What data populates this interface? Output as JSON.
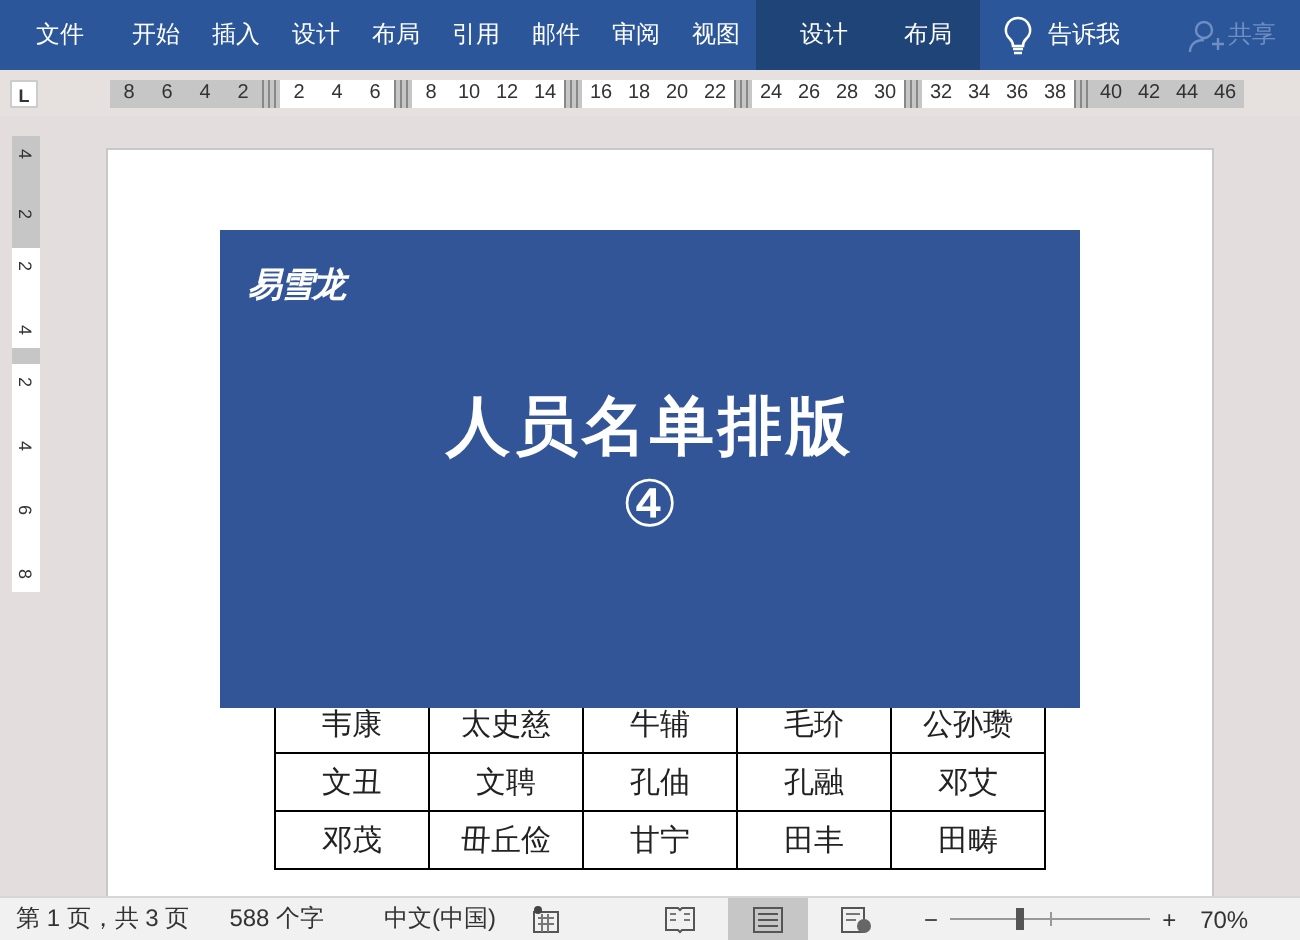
{
  "ribbon": {
    "file_tab": "文件",
    "tabs": [
      {
        "label": "开始",
        "selected": false,
        "contextual": false
      },
      {
        "label": "插入",
        "selected": false,
        "contextual": false
      },
      {
        "label": "设计",
        "selected": false,
        "contextual": false
      },
      {
        "label": "布局",
        "selected": false,
        "contextual": false
      },
      {
        "label": "引用",
        "selected": false,
        "contextual": false
      },
      {
        "label": "邮件",
        "selected": false,
        "contextual": false
      },
      {
        "label": "审阅",
        "selected": false,
        "contextual": false
      },
      {
        "label": "视图",
        "selected": false,
        "contextual": false
      },
      {
        "label": "设计",
        "selected": false,
        "contextual": true
      },
      {
        "label": "布局",
        "selected": false,
        "contextual": true
      }
    ],
    "tell_me": "告诉我",
    "share": {
      "label": "共享",
      "disabled": true
    }
  },
  "ruler": {
    "tab_selector": "L",
    "segments": [
      {
        "margin": true,
        "labels": [
          "8",
          "6",
          "4",
          "2"
        ]
      },
      {
        "margin": false,
        "labels": [
          "2",
          "4",
          "6"
        ]
      },
      {
        "margin": false,
        "labels": [
          "8",
          "10",
          "12",
          "14"
        ]
      },
      {
        "margin": false,
        "labels": [
          "16",
          "18",
          "20",
          "22"
        ]
      },
      {
        "margin": false,
        "labels": [
          "24",
          "26",
          "28",
          "30"
        ]
      },
      {
        "margin": false,
        "labels": [
          "32",
          "34",
          "36",
          "38"
        ]
      },
      {
        "margin": true,
        "labels": [
          "40",
          "42",
          "44",
          "46"
        ]
      }
    ],
    "vertical": [
      {
        "margin": true,
        "labels": [
          "4",
          "2"
        ]
      },
      {
        "margin": false,
        "labels": [
          "2",
          "4"
        ]
      },
      {
        "margin": false,
        "labels": [
          "2",
          "4",
          "6",
          "8"
        ]
      }
    ]
  },
  "document": {
    "banner": {
      "logo": "易雪龙",
      "title": "人员名单排版",
      "number": "④"
    },
    "table": {
      "rows": [
        [
          "韦康",
          "太史慈",
          "牛辅",
          "毛玠",
          "公孙瓒"
        ],
        [
          "文丑",
          "文聘",
          "孔伷",
          "孔融",
          "邓艾"
        ],
        [
          "邓茂",
          "毌丘俭",
          "甘宁",
          "田丰",
          "田畴"
        ]
      ]
    }
  },
  "status_bar": {
    "page": "第 1 页，共 3 页",
    "words": "588 个字",
    "language": "中文(中国)",
    "views": [
      {
        "kind": "read",
        "selected": false
      },
      {
        "kind": "print",
        "selected": true
      },
      {
        "kind": "web",
        "selected": false
      }
    ],
    "zoom": {
      "minus": "−",
      "plus": "+",
      "level": 0.35,
      "value": "70%"
    }
  }
}
